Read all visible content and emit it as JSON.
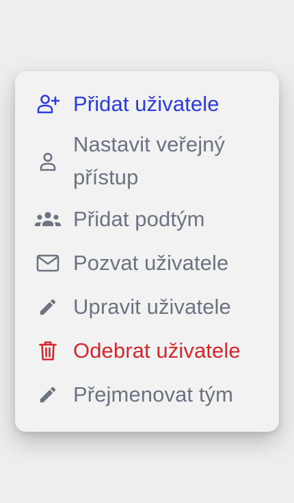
{
  "colors": {
    "default": "#6b7280",
    "primary": "#2b3be0",
    "danger": "#d6262b"
  },
  "menu": {
    "items": [
      {
        "label": "Přidat uživatele",
        "icon": "user-plus-icon",
        "tone": "primary"
      },
      {
        "label": "Nastavit veřejný přístup",
        "icon": "user-outline-icon",
        "tone": "default"
      },
      {
        "label": "Přidat podtým",
        "icon": "users-group-icon",
        "tone": "default"
      },
      {
        "label": "Pozvat uživatele",
        "icon": "envelope-icon",
        "tone": "default"
      },
      {
        "label": "Upravit uživatele",
        "icon": "pencil-icon",
        "tone": "default"
      },
      {
        "label": "Odebrat uživatele",
        "icon": "trash-icon",
        "tone": "danger"
      },
      {
        "label": "Přejmenovat tým",
        "icon": "pencil-icon",
        "tone": "default"
      }
    ]
  }
}
